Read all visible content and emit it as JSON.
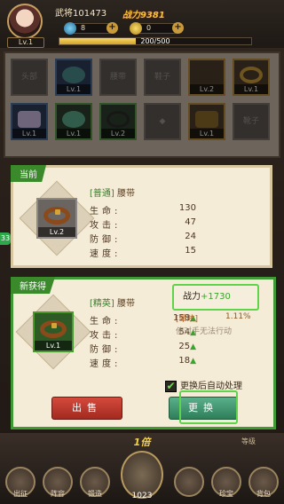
{
  "header": {
    "level": "Lv.1",
    "player_name": "武将101473",
    "power": "战力9381",
    "gems": "8",
    "coins": "0",
    "exp_text": "200/500",
    "exp_fraction": 0.4
  },
  "equipment_slots": [
    {
      "name": "头部",
      "lv": ""
    },
    {
      "name": "",
      "lv": "Lv.1"
    },
    {
      "name": "腰带",
      "lv": ""
    },
    {
      "name": "鞋子",
      "lv": ""
    },
    {
      "name": "",
      "lv": "Lv.2"
    },
    {
      "name": "",
      "lv": "Lv.1"
    },
    {
      "name": "",
      "lv": "Lv.1"
    },
    {
      "name": "",
      "lv": "Lv.1"
    },
    {
      "name": "",
      "lv": "Lv.2"
    },
    {
      "name": "",
      "lv": ""
    },
    {
      "name": "",
      "lv": "Lv.1"
    },
    {
      "name": "靴子",
      "lv": ""
    }
  ],
  "current": {
    "tag": "当前",
    "item_lv": "Lv.2",
    "quality": "[普通]",
    "item_name": "腰带",
    "stats": [
      {
        "label": "生命:",
        "value": "130"
      },
      {
        "label": "攻击:",
        "value": "47"
      },
      {
        "label": "防御:",
        "value": "24"
      },
      {
        "label": "速度:",
        "value": "15"
      }
    ]
  },
  "new_item": {
    "tag": "新获得",
    "item_lv": "Lv.1",
    "quality": "[精英]",
    "item_name": "腰带",
    "power_label": "战力",
    "power_value": "+1730",
    "passive_name": "[晕眩]",
    "passive_pct": "1.11%",
    "passive_desc": "使对手无法行动",
    "stats": [
      {
        "label": "生命:",
        "value": "158"
      },
      {
        "label": "攻击:",
        "value": "54"
      },
      {
        "label": "防御:",
        "value": "25"
      },
      {
        "label": "速度:",
        "value": "18"
      }
    ],
    "auto_label": "更换后自动处理",
    "sell_label": "出售",
    "swap_label": "更换"
  },
  "bottom": {
    "multiplier": "1倍",
    "hammer_count": "1023",
    "nav": [
      "出征",
      "阵容",
      "锻造",
      "",
      "",
      "珍宝",
      "背包"
    ],
    "level_label": "等级"
  },
  "side_chip": "33"
}
